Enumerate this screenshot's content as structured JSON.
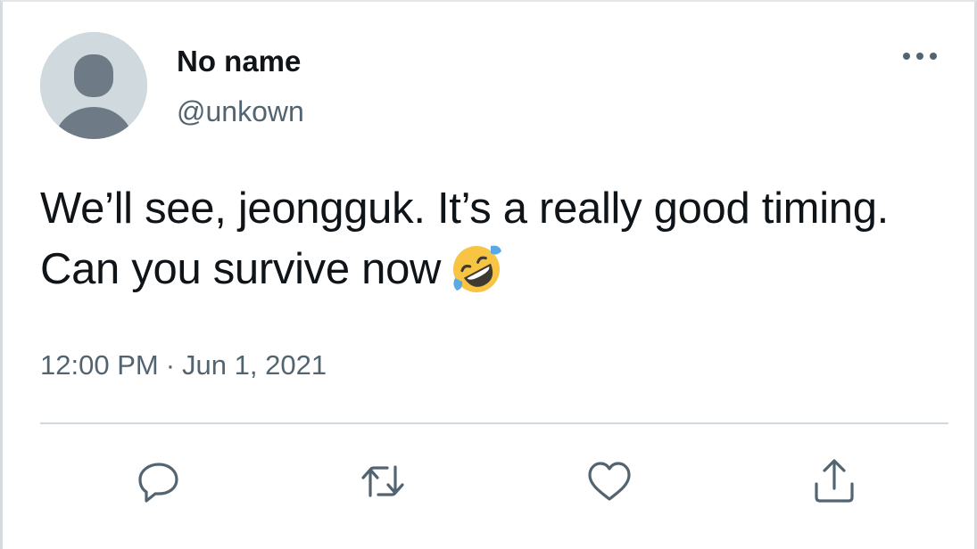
{
  "tweet": {
    "display_name": "No name",
    "handle": "@unkown",
    "text": "We’ll see, jeongguk. It’s a really good timing. Can you survive now",
    "emoji": "rolling-on-the-floor-laughing",
    "time": "12:00 PM",
    "separator": "·",
    "date": "Jun 1, 2021"
  },
  "actions": [
    {
      "name": "reply",
      "icon": "reply-icon"
    },
    {
      "name": "retweet",
      "icon": "retweet-icon"
    },
    {
      "name": "like",
      "icon": "heart-icon"
    },
    {
      "name": "share",
      "icon": "share-icon"
    }
  ],
  "colors": {
    "text": "#0f1419",
    "secondary": "#536471",
    "divider": "#cfd9de",
    "avatar_bg": "#cfd9de",
    "avatar_fg": "#6e7b87"
  }
}
